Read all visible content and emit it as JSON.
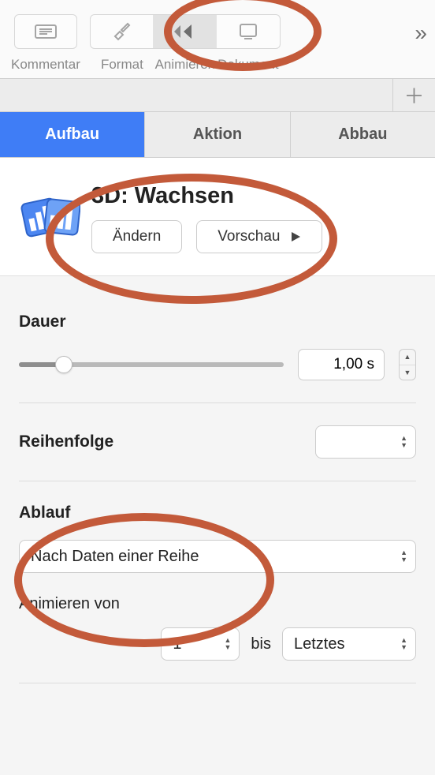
{
  "toolbar": {
    "comment_label": "Kommentar",
    "format_label": "Format",
    "animate_label": "Animieren",
    "document_label": "Dokument"
  },
  "tabs": {
    "aufbau": "Aufbau",
    "aktion": "Aktion",
    "abbau": "Abbau"
  },
  "effect": {
    "title": "3D: Wachsen",
    "change_label": "Ändern",
    "preview_label": "Vorschau"
  },
  "sections": {
    "duration_label": "Dauer",
    "duration_value": "1,00 s",
    "order_label": "Reihenfolge",
    "order_value": "",
    "delivery_label": "Ablauf",
    "delivery_value": "Nach Daten einer Reihe",
    "animate_from_label": "Animieren von",
    "from_value": "1",
    "bis_label": "bis",
    "to_value": "Letztes"
  }
}
